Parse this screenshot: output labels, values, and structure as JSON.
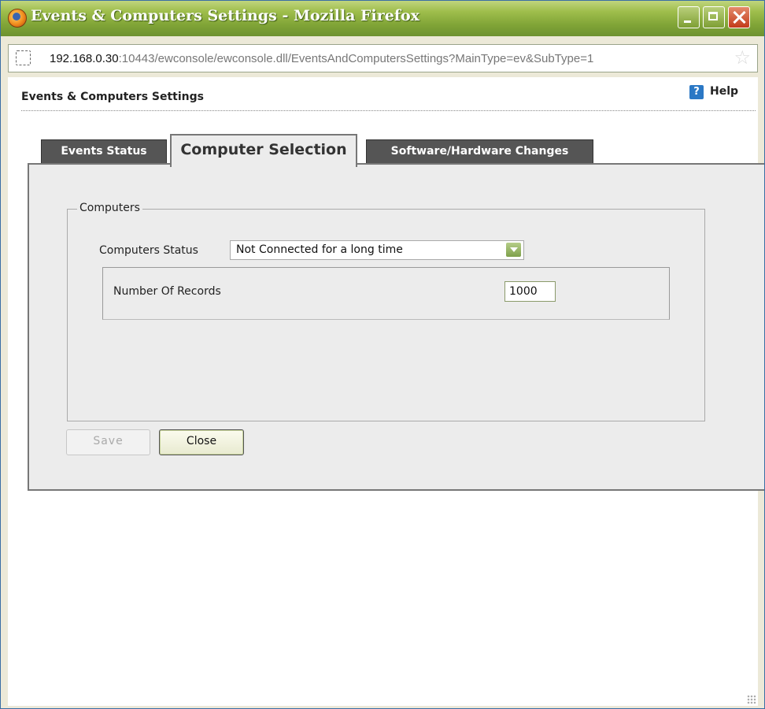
{
  "window": {
    "title": "Events & Computers Settings - Mozilla Firefox"
  },
  "address_bar": {
    "host": "192.168.0.30",
    "path": ":10443/ewconsole/ewconsole.dll/EventsAndComputersSettings?MainType=ev&SubType=1"
  },
  "page": {
    "title": "Events & Computers Settings",
    "help_label": "Help"
  },
  "tabs": [
    {
      "label": "Events Status",
      "active": false
    },
    {
      "label": "Computer Selection",
      "active": true
    },
    {
      "label": "Software/Hardware Changes",
      "active": false
    }
  ],
  "computers_group": {
    "legend": "Computers",
    "status_label": "Computers Status",
    "status_value": "Not Connected for a long time",
    "records_label": "Number Of Records",
    "records_value": "1000"
  },
  "buttons": {
    "save": "Save",
    "close": "Close"
  }
}
